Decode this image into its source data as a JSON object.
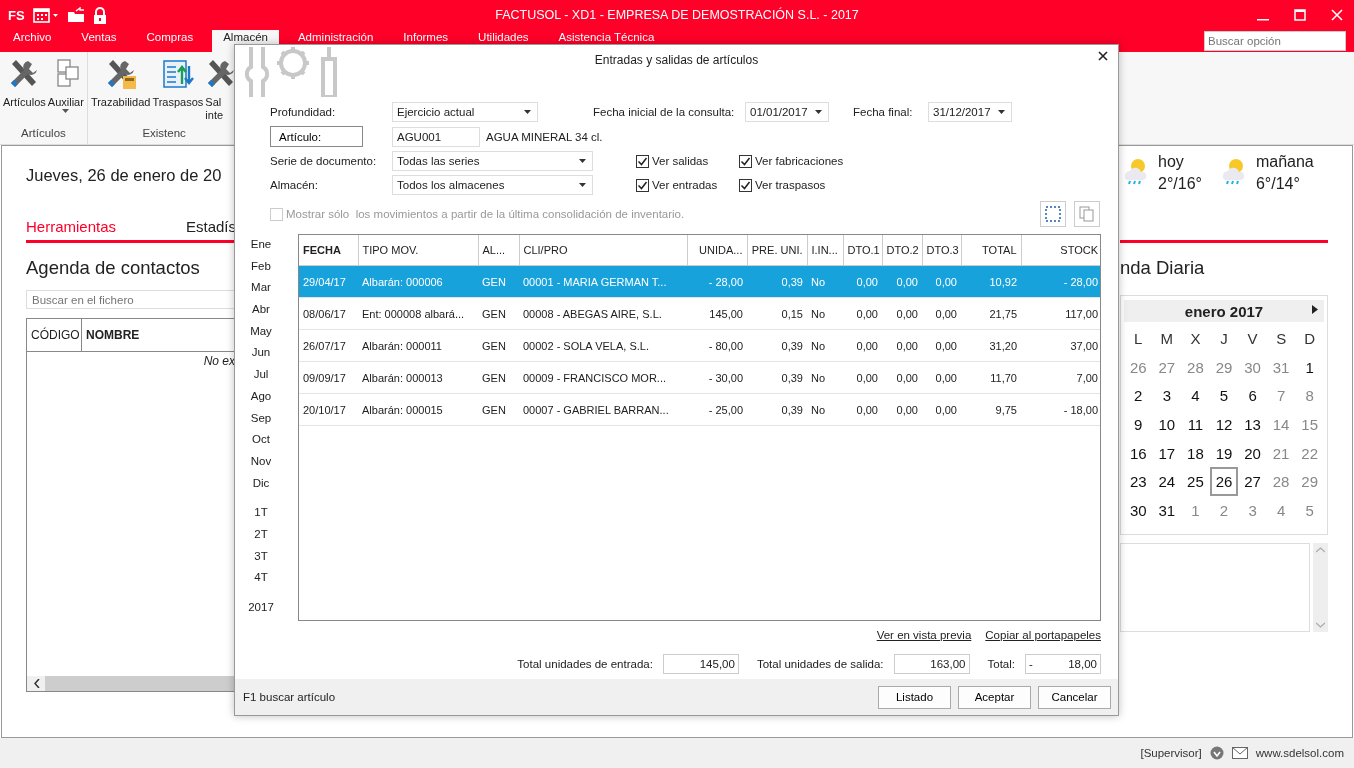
{
  "window": {
    "logo": "FS",
    "title": "FACTUSOL - XD1 - EMPRESA DE DEMOSTRACIÓN S.L. - 2017"
  },
  "menu_tabs": [
    {
      "label": "Archivo",
      "selected": false
    },
    {
      "label": "Ventas",
      "selected": false
    },
    {
      "label": "Compras",
      "selected": false
    },
    {
      "label": "Almacén",
      "selected": true
    },
    {
      "label": "Administración",
      "selected": false
    },
    {
      "label": "Informes",
      "selected": false
    },
    {
      "label": "Utilidades",
      "selected": false
    },
    {
      "label": "Asistencia Técnica",
      "selected": false
    }
  ],
  "option_search": {
    "placeholder": "Buscar opción"
  },
  "ribbon": {
    "groups": [
      {
        "label": "Artículos",
        "buttons": [
          {
            "kind": "tools",
            "lines": [
              "Artículos"
            ],
            "dropdown": false
          },
          {
            "kind": "blocks",
            "lines": [
              "Auxiliar"
            ],
            "dropdown": true
          }
        ]
      },
      {
        "label": "Existenc",
        "buttons": [
          {
            "kind": "trace",
            "lines": [
              "Trazabilidad"
            ],
            "dropdown": false
          },
          {
            "kind": "transfer",
            "lines": [
              "Traspasos"
            ],
            "dropdown": false
          },
          {
            "kind": "tools",
            "lines": [
              "Sal",
              "inte"
            ],
            "dropdown": false
          }
        ]
      }
    ]
  },
  "home": {
    "date_heading": "Jueves, 26 de enero de 20",
    "tabs": [
      {
        "label": "Herramientas",
        "selected": true
      },
      {
        "label": "Estadís",
        "selected": false
      }
    ],
    "contacts": {
      "title": "Agenda de contactos",
      "search_placeholder": "Buscar en el fichero",
      "columns": [
        {
          "label": "CÓDIGO",
          "sorted": false
        },
        {
          "label": "NOMBRE",
          "sorted": true
        }
      ],
      "empty_text": "No ex"
    },
    "weather": [
      {
        "day": "hoy",
        "temps": "2°/16°"
      },
      {
        "day": "mañana",
        "temps": "6°/14°"
      }
    ],
    "agenda_title": "nda Diaria",
    "calendar": {
      "month": "enero 2017",
      "weekdays": [
        "L",
        "M",
        "X",
        "J",
        "V",
        "S",
        "D"
      ],
      "days": [
        {
          "day": "26",
          "muted": true,
          "today": false
        },
        {
          "day": "27",
          "muted": true,
          "today": false
        },
        {
          "day": "28",
          "muted": true,
          "today": false
        },
        {
          "day": "29",
          "muted": true,
          "today": false
        },
        {
          "day": "30",
          "muted": true,
          "today": false
        },
        {
          "day": "31",
          "muted": true,
          "today": false
        },
        {
          "day": "1",
          "muted": false,
          "today": false
        },
        {
          "day": "2",
          "muted": false,
          "today": false
        },
        {
          "day": "3",
          "muted": false,
          "today": false
        },
        {
          "day": "4",
          "muted": false,
          "today": false
        },
        {
          "day": "5",
          "muted": false,
          "today": false
        },
        {
          "day": "6",
          "muted": false,
          "today": false
        },
        {
          "day": "7",
          "muted": true,
          "today": false
        },
        {
          "day": "8",
          "muted": true,
          "today": false
        },
        {
          "day": "9",
          "muted": false,
          "today": false
        },
        {
          "day": "10",
          "muted": false,
          "today": false
        },
        {
          "day": "11",
          "muted": false,
          "today": false
        },
        {
          "day": "12",
          "muted": false,
          "today": false
        },
        {
          "day": "13",
          "muted": false,
          "today": false
        },
        {
          "day": "14",
          "muted": true,
          "today": false
        },
        {
          "day": "15",
          "muted": true,
          "today": false
        },
        {
          "day": "16",
          "muted": false,
          "today": false
        },
        {
          "day": "17",
          "muted": false,
          "today": false
        },
        {
          "day": "18",
          "muted": false,
          "today": false
        },
        {
          "day": "19",
          "muted": false,
          "today": false
        },
        {
          "day": "20",
          "muted": false,
          "today": false
        },
        {
          "day": "21",
          "muted": true,
          "today": false
        },
        {
          "day": "22",
          "muted": true,
          "today": false
        },
        {
          "day": "23",
          "muted": false,
          "today": false
        },
        {
          "day": "24",
          "muted": false,
          "today": false
        },
        {
          "day": "25",
          "muted": false,
          "today": false
        },
        {
          "day": "26",
          "muted": false,
          "today": true
        },
        {
          "day": "27",
          "muted": false,
          "today": false
        },
        {
          "day": "28",
          "muted": true,
          "today": false
        },
        {
          "day": "29",
          "muted": true,
          "today": false
        },
        {
          "day": "30",
          "muted": false,
          "today": false
        },
        {
          "day": "31",
          "muted": false,
          "today": false
        },
        {
          "day": "1",
          "muted": true,
          "today": false
        },
        {
          "day": "2",
          "muted": true,
          "today": false
        },
        {
          "day": "3",
          "muted": true,
          "today": false
        },
        {
          "day": "4",
          "muted": true,
          "today": false
        },
        {
          "day": "5",
          "muted": true,
          "today": false
        }
      ]
    }
  },
  "dialog": {
    "title": "Entradas y salidas de artículos",
    "depth": {
      "label": "Profundidad:",
      "value": "Ejercicio actual"
    },
    "start_date": {
      "label": "Fecha inicial de la consulta:",
      "value": "01/01/2017"
    },
    "end_date": {
      "label": "Fecha final:",
      "value": "31/12/2017"
    },
    "article": {
      "button": "Artículo:",
      "code": "AGU001",
      "description": "AGUA MINERAL 34 cl."
    },
    "series": {
      "label": "Serie de documento:",
      "value": "Todas las series"
    },
    "warehouse": {
      "label": "Almacén:",
      "value": "Todos los almacenes"
    },
    "filters": [
      {
        "label": "Ver salidas",
        "checked": true
      },
      {
        "label": "Ver fabricaciones",
        "checked": true
      },
      {
        "label": "Ver entradas",
        "checked": true
      },
      {
        "label": "Ver traspasos",
        "checked": true
      }
    ],
    "consolidation": {
      "label": "Mostrar sólo  los movimientos a partir de la última consolidación de inventario.",
      "checked": false,
      "disabled": true
    },
    "periods": {
      "months": [
        "Ene",
        "Feb",
        "Mar",
        "Abr",
        "May",
        "Jun",
        "Jul",
        "Ago",
        "Sep",
        "Oct",
        "Nov",
        "Dic"
      ],
      "quarters": [
        "1T",
        "2T",
        "3T",
        "4T"
      ],
      "year": "2017"
    },
    "table": {
      "columns": [
        {
          "label": "FECHA",
          "sorted": true
        },
        {
          "label": "TIPO MOV.",
          "sorted": false
        },
        {
          "label": "AL...",
          "sorted": false
        },
        {
          "label": "CLI/PRO",
          "sorted": false
        },
        {
          "label": "UNIDA...",
          "sorted": false
        },
        {
          "label": "PRE. UNI.",
          "sorted": false
        },
        {
          "label": "I.IN...",
          "sorted": false
        },
        {
          "label": "DTO.1",
          "sorted": false
        },
        {
          "label": "DTO.2",
          "sorted": false
        },
        {
          "label": "DTO.3",
          "sorted": false
        },
        {
          "label": "TOTAL",
          "sorted": false
        },
        {
          "label": "STOCK",
          "sorted": false
        }
      ],
      "rows": [
        {
          "selected": true,
          "cells": [
            "29/04/17",
            "Albarán: 000006",
            "GEN",
            "00001 - MARIA GERMAN T...",
            "- 28,00",
            "0,39",
            "No",
            "0,00",
            "0,00",
            "0,00",
            "10,92",
            "- 28,00"
          ]
        },
        {
          "selected": false,
          "cells": [
            "08/06/17",
            "Ent: 000008 albará...",
            "GEN",
            "00008 - ABEGAS AIRE, S.L.",
            "145,00",
            "0,15",
            "No",
            "0,00",
            "0,00",
            "0,00",
            "21,75",
            "117,00"
          ]
        },
        {
          "selected": false,
          "cells": [
            "26/07/17",
            "Albarán: 000011",
            "GEN",
            "00002 - SOLA VELA, S.L.",
            "- 80,00",
            "0,39",
            "No",
            "0,00",
            "0,00",
            "0,00",
            "31,20",
            "37,00"
          ]
        },
        {
          "selected": false,
          "cells": [
            "09/09/17",
            "Albarán: 000013",
            "GEN",
            "00009 - FRANCISCO MOR...",
            "- 30,00",
            "0,39",
            "No",
            "0,00",
            "0,00",
            "0,00",
            "11,70",
            "7,00"
          ]
        },
        {
          "selected": false,
          "cells": [
            "20/10/17",
            "Albarán: 000015",
            "GEN",
            "00007 - GABRIEL BARRAN...",
            "- 25,00",
            "0,39",
            "No",
            "0,00",
            "0,00",
            "0,00",
            "9,75",
            "- 18,00"
          ]
        }
      ]
    },
    "links": [
      "Ver en vista previa",
      "Copiar al portapapeles"
    ],
    "totals": {
      "incoming": {
        "label": "Total unidades de entrada:",
        "value": "145,00"
      },
      "outgoing": {
        "label": "Total unidades de salida:",
        "value": "163,00"
      },
      "total": {
        "label": "Total:",
        "sign": "-",
        "value": "18,00"
      }
    },
    "hint": "F1 buscar artículo",
    "buttons": [
      "Listado",
      "Aceptar",
      "Cancelar"
    ]
  },
  "status_bar": {
    "user": "[Supervisor]",
    "website": "www.sdelsol.com"
  }
}
